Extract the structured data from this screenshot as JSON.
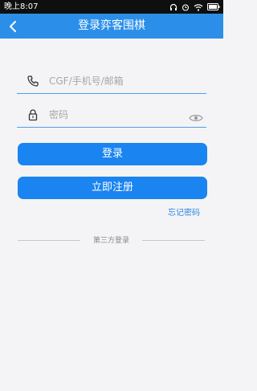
{
  "status_bar": {
    "time": "晚上8:07",
    "icons": [
      "headset-icon",
      "alarm-icon",
      "wifi-icon",
      "battery-icon"
    ]
  },
  "header": {
    "title": "登录弈客围棋",
    "back_icon": "chevron-left-icon"
  },
  "login_form": {
    "phone_field": {
      "icon": "phone-icon",
      "placeholder": "CGF/手机号/邮箱",
      "value": ""
    },
    "password_field": {
      "icon": "lock-icon",
      "placeholder": "密码",
      "value": "",
      "toggle_icon": "eye-icon"
    },
    "login_button": "登录",
    "register_button": "立即注册",
    "forgot_password": "忘记密码"
  },
  "third_party": {
    "label": "第三方登录"
  },
  "colors": {
    "header": "#2b8fea",
    "button": "#1a84f0",
    "link": "#2b86e0",
    "background": "#f4f4f6"
  }
}
